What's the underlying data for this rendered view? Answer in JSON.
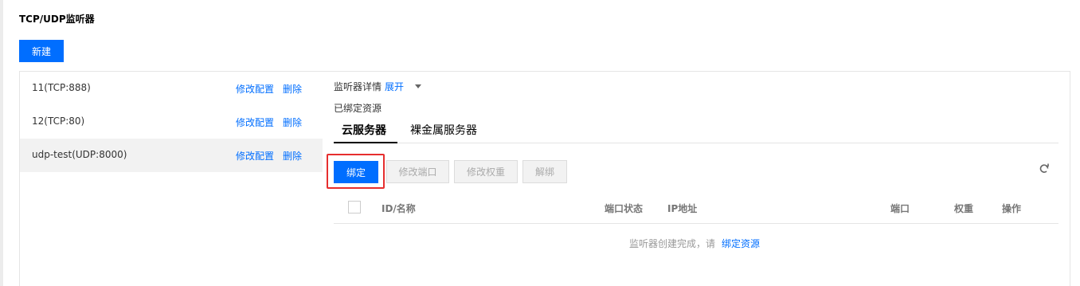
{
  "title": "TCP/UDP监听器",
  "new_button": "新建",
  "listeners": [
    {
      "name": "11(TCP:888)",
      "edit": "修改配置",
      "delete": "删除",
      "active": false
    },
    {
      "name": "12(TCP:80)",
      "edit": "修改配置",
      "delete": "删除",
      "active": false
    },
    {
      "name": "udp-test(UDP:8000)",
      "edit": "修改配置",
      "delete": "删除",
      "active": true
    }
  ],
  "detail": {
    "label": "监听器详情",
    "expand": "展开",
    "bound_label": "已绑定资源"
  },
  "tabs": [
    {
      "label": "云服务器",
      "active": true
    },
    {
      "label": "裸金属服务器",
      "active": false
    }
  ],
  "toolbar": {
    "bind": "绑定",
    "modify_port": "修改端口",
    "modify_weight": "修改权重",
    "unbind": "解绑"
  },
  "table": {
    "headers": [
      "ID/名称",
      "端口状态",
      "IP地址",
      "端口",
      "权重",
      "操作"
    ]
  },
  "empty": {
    "text": "监听器创建完成，请",
    "link": "绑定资源"
  },
  "colors": {
    "primary": "#006eff",
    "highlight": "#e62e2e"
  },
  "icons": {
    "refresh": "refresh-icon",
    "expand_caret": "caret-down-icon"
  }
}
